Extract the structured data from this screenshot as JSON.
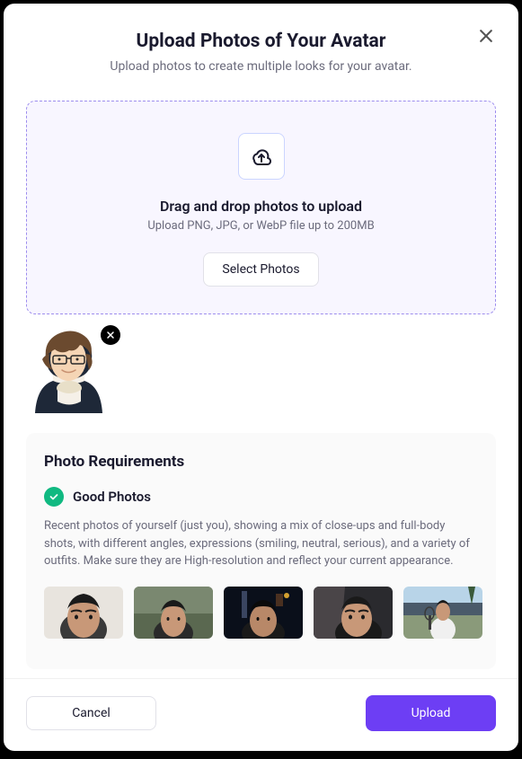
{
  "header": {
    "title": "Upload Photos of Your Avatar",
    "subtitle": "Upload photos to create multiple looks for your avatar."
  },
  "dropzone": {
    "title": "Drag and drop photos to upload",
    "subtitle": "Upload PNG, JPG, or WebP file up to 200MB",
    "select_label": "Select Photos"
  },
  "requirements": {
    "title": "Photo Requirements",
    "good": {
      "label": "Good Photos",
      "description": "Recent photos of yourself (just you), showing a mix of close-ups and full-body shots, with different angles, expressions (smiling, neutral, serious), and a variety of outfits. Make sure they are High-resolution and reflect your current appearance."
    }
  },
  "footer": {
    "cancel_label": "Cancel",
    "upload_label": "Upload"
  }
}
